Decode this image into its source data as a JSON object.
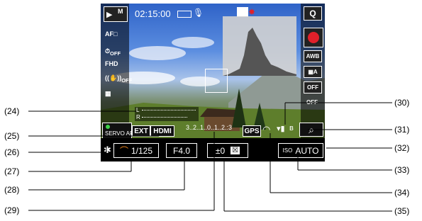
{
  "status": {
    "shooting_mode": "M",
    "time_remaining": "02:15:00",
    "af_method": "AF",
    "af_operation": "SERVO AF",
    "ext_label": "EXT",
    "hdmi_label": "HDMI",
    "gps_label": "GPS",
    "iso": "AUTO"
  },
  "exposure": {
    "shutter": "1/125",
    "aperture": "F4.0",
    "exposure_comp": "±0",
    "meter_scale": "3..2..1..0..1..2.:3"
  },
  "sidebar_labels": [
    "AF",
    "OFF",
    "FHD",
    "OFF"
  ],
  "right_labels": [
    "Q",
    "AWB",
    "A",
    "OFF",
    "OFF"
  ],
  "audio": {
    "l": "L",
    "r": "R"
  },
  "callouts": {
    "left": [
      "(24)",
      "(25)",
      "(26)",
      "(27)",
      "(28)",
      "(29)"
    ],
    "right": [
      "(30)",
      "(31)",
      "(32)",
      "(33)",
      "(34)",
      "(35)"
    ]
  },
  "colors": {
    "record": "#e0202a",
    "overlay_bg": "#000000"
  }
}
